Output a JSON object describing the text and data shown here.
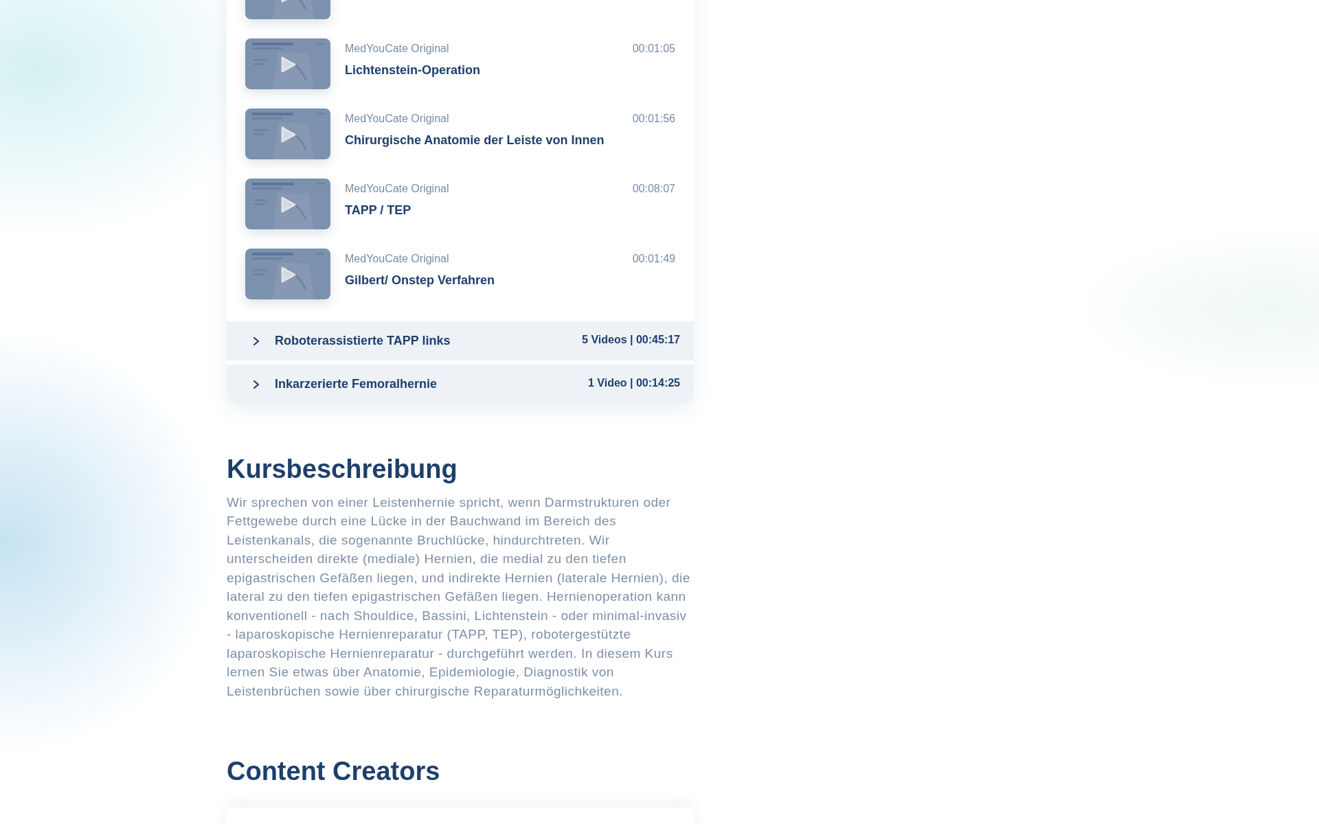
{
  "lessons": [
    {
      "source": "MedYouCate Original",
      "title": "Lichtenstein-Operation",
      "duration": "00:01:05"
    },
    {
      "source": "MedYouCate Original",
      "title": "Chirurgische Anatomie der Leiste von Innen",
      "duration": "00:01:56"
    },
    {
      "source": "MedYouCate Original",
      "title": "TAPP / TEP",
      "duration": "00:08:07"
    },
    {
      "source": "MedYouCate Original",
      "title": "Gilbert/ Onstep Verfahren",
      "duration": "00:01:49"
    }
  ],
  "sections": [
    {
      "title": "Roboterassistierte TAPP links",
      "summary": "5 Videos | 00:45:17",
      "expanded": false
    },
    {
      "title": "Inkarzerierte Femoralhernie",
      "summary": "1 Video | 00:14:25",
      "expanded": false
    }
  ],
  "description": {
    "heading": "Kursbeschreibung",
    "text": "Wir sprechen von einer Leistenhernie spricht, wenn Darmstrukturen oder Fettgewebe durch eine Lücke in der Bauchwand im Bereich des Leistenkanals, die sogenannte Bruchlücke, hindurchtreten. Wir unterscheiden direkte (mediale) Hernien, die medial zu den tiefen epigastrischen Gefäßen liegen, und indirekte Hernien (laterale Hernien), die lateral zu den tiefen epigastrischen Gefäßen liegen. Hernienoperation kann konventionell - nach Shouldice, Bassini, Lichtenstein - oder minimal-invasiv - laparoskopische Hernienreparatur (TAPP, TEP), robotergestützte laparoskopische Hernienreparatur - durchgeführt werden. In diesem Kurs lernen Sie etwas über Anatomie, Epidemiologie, Diagnostik von Leistenbrüchen sowie über chirurgische Reparaturmöglichkeiten."
  },
  "creators": {
    "heading": "Content Creators"
  }
}
